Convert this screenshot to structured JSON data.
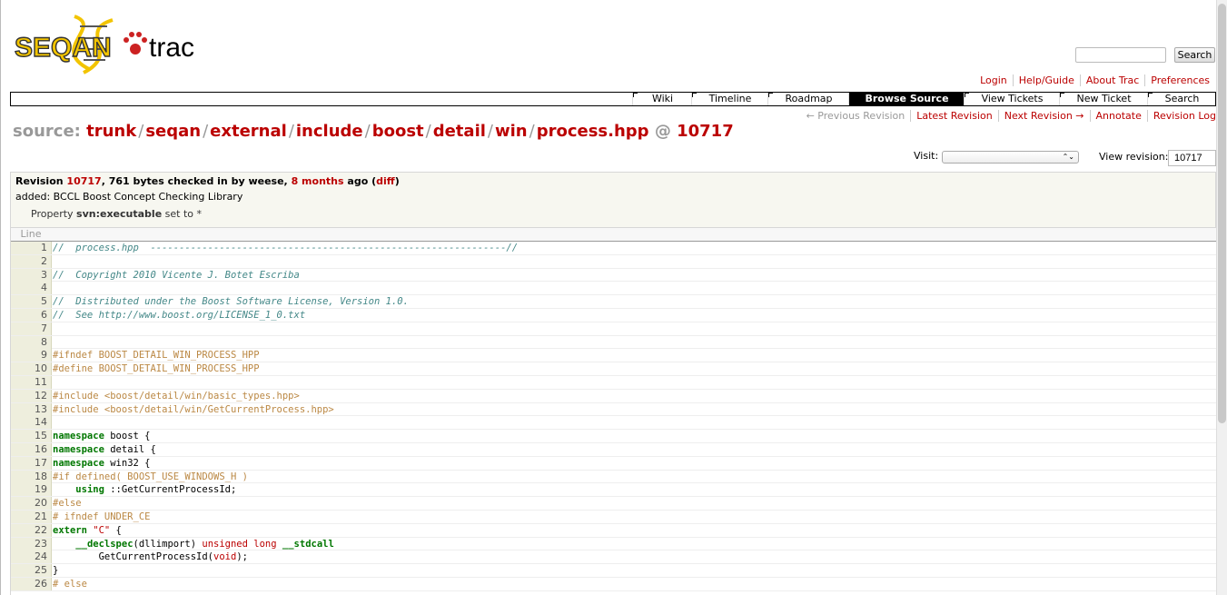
{
  "logo": {
    "text_left": "SEQAN",
    "text_right": "trac"
  },
  "search": {
    "button_label": "Search",
    "placeholder": ""
  },
  "metanav": [
    "Login",
    "Help/Guide",
    "About Trac",
    "Preferences"
  ],
  "mainnav": [
    "Wiki",
    "Timeline",
    "Roadmap",
    "Browse Source",
    "View Tickets",
    "New Ticket",
    "Search"
  ],
  "mainnav_active": "Browse Source",
  "ctxtnav": {
    "prev": "← Previous Revision",
    "latest": "Latest Revision",
    "next": "Next Revision →",
    "annotate": "Annotate",
    "log": "Revision Log"
  },
  "path": {
    "prefix": "source:",
    "parts": [
      "trunk",
      "seqan",
      "external",
      "include",
      "boost",
      "detail",
      "win",
      "process.hpp"
    ],
    "at": "@",
    "rev": "10717"
  },
  "visit": {
    "label": "Visit:",
    "select_arrow": "⌃⌄"
  },
  "view_revision": {
    "label": "View revision:",
    "value": "10717"
  },
  "info": {
    "revision_label": "Revision",
    "revision": "10717",
    "checked_in": ", 761 bytes checked in by weese,",
    "age": "8 months",
    "ago": "ago (",
    "diff": "diff",
    "close": ")",
    "message": "added: BCCL Boost Concept Checking Library",
    "property_pre": "Property",
    "property_name": "svn:executable",
    "property_post": "set to *"
  },
  "code": {
    "header": "Line",
    "lines": [
      {
        "n": "1",
        "t": "//  process.hpp  --------------------------------------------------------------//"
      },
      {
        "n": "2",
        "t": ""
      },
      {
        "n": "3",
        "t": "//  Copyright 2010 Vicente J. Botet Escriba"
      },
      {
        "n": "4",
        "t": ""
      },
      {
        "n": "5",
        "t": "//  Distributed under the Boost Software License, Version 1.0."
      },
      {
        "n": "6",
        "t": "//  See http://www.boost.org/LICENSE_1_0.txt"
      },
      {
        "n": "7",
        "t": ""
      },
      {
        "n": "8",
        "t": ""
      },
      {
        "n": "9",
        "t": "#ifndef BOOST_DETAIL_WIN_PROCESS_HPP"
      },
      {
        "n": "10",
        "t": "#define BOOST_DETAIL_WIN_PROCESS_HPP"
      },
      {
        "n": "11",
        "t": ""
      },
      {
        "n": "12",
        "t": "#include <boost/detail/win/basic_types.hpp>"
      },
      {
        "n": "13",
        "t": "#include <boost/detail/win/GetCurrentProcess.hpp>"
      },
      {
        "n": "14",
        "t": ""
      },
      {
        "n": "15",
        "t": "namespace boost {"
      },
      {
        "n": "16",
        "t": "namespace detail {"
      },
      {
        "n": "17",
        "t": "namespace win32 {"
      },
      {
        "n": "18",
        "t": "#if defined( BOOST_USE_WINDOWS_H )"
      },
      {
        "n": "19",
        "t": "    using ::GetCurrentProcessId;"
      },
      {
        "n": "20",
        "t": "#else"
      },
      {
        "n": "21",
        "t": "# ifndef UNDER_CE"
      },
      {
        "n": "22",
        "t": "extern \"C\" {"
      },
      {
        "n": "23",
        "t": "    __declspec(dllimport) unsigned long __stdcall"
      },
      {
        "n": "24",
        "t": "        GetCurrentProcessId(void);"
      },
      {
        "n": "25",
        "t": "}"
      },
      {
        "n": "26",
        "t": "# else"
      }
    ]
  }
}
